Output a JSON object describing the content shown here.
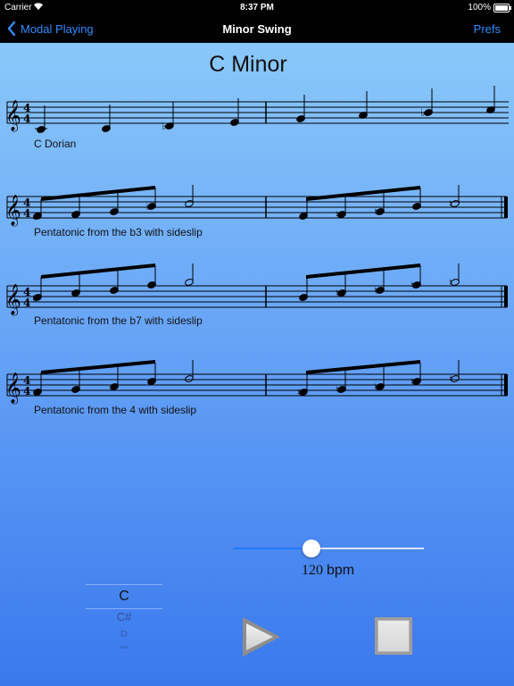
{
  "status_bar": {
    "carrier": "Carrier",
    "time": "8:37 PM",
    "battery": "100%"
  },
  "nav": {
    "back_label": "Modal Playing",
    "title": "Minor Swing",
    "prefs_label": "Prefs"
  },
  "page": {
    "title": "C Minor"
  },
  "staves": [
    {
      "caption": "C Dorian"
    },
    {
      "caption": "Pentatonic from the b3 with sideslip"
    },
    {
      "caption": "Pentatonic from the b7 with sideslip"
    },
    {
      "caption": "Pentatonic from the 4 with sideslip"
    }
  ],
  "time_signature": {
    "top": "4",
    "bottom": "4"
  },
  "tempo": {
    "value": "120",
    "unit": "bpm",
    "slider_fraction": 0.41
  },
  "key_picker": {
    "selected": "C",
    "options": [
      "C#",
      "D",
      "Eb"
    ]
  },
  "icons": {
    "play": "play-icon",
    "stop": "stop-icon",
    "back": "chevron-left-icon",
    "wifi": "wifi-icon",
    "battery": "battery-icon"
  },
  "colors": {
    "accent": "#2f8cff",
    "nav_bg": "#000000",
    "slider_fill": "#1f7aff"
  }
}
